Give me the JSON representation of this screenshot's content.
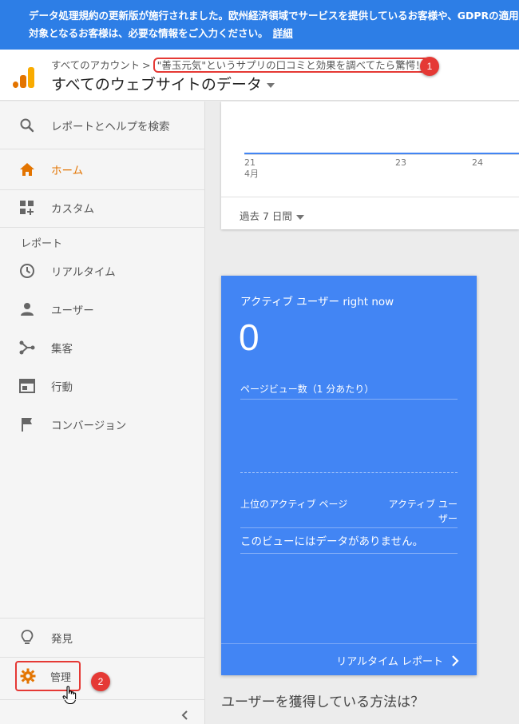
{
  "banner": {
    "text": "データ処理規約の更新版が施行されました。欧州経済領域でサービスを提供しているお客様や、GDPRの適用対象となるお客様は、必要な情報をご入力ください。",
    "link": "詳細"
  },
  "header": {
    "breadcrumb_root": "すべてのアカウント",
    "breadcrumb_sep": ">",
    "breadcrumb_current": "\"善玉元気\"というサプリの口コミと効果を調べてたら驚愕！",
    "view_title": "すべてのウェブサイトのデータ",
    "badge1": "1"
  },
  "sidebar": {
    "search": "レポートとヘルプを検索",
    "home": "ホーム",
    "custom": "カスタム",
    "section_report": "レポート",
    "realtime": "リアルタイム",
    "users": "ユーザー",
    "acquisition": "集客",
    "behavior": "行動",
    "conversion": "コンバージョン",
    "discover": "発見",
    "admin": "管理",
    "badge2": "2",
    "accent_color": "#e37400"
  },
  "chart_card": {
    "ticks": [
      "21",
      "23",
      "24"
    ],
    "month": "4月",
    "range": "過去 7 日間"
  },
  "realtime_card": {
    "title": "アクティブ ユーザー right now",
    "count": "0",
    "pageviews_label": "ページビュー数（1 分あたり）",
    "col_pages": "上位のアクティブ ページ",
    "col_users": "アクティブ ユーザー",
    "empty": "このビューにはデータがありません。",
    "link": "リアルタイム レポート",
    "bg_color": "#4285f4"
  },
  "acquisition_heading": "ユーザーを獲得している方法は？"
}
